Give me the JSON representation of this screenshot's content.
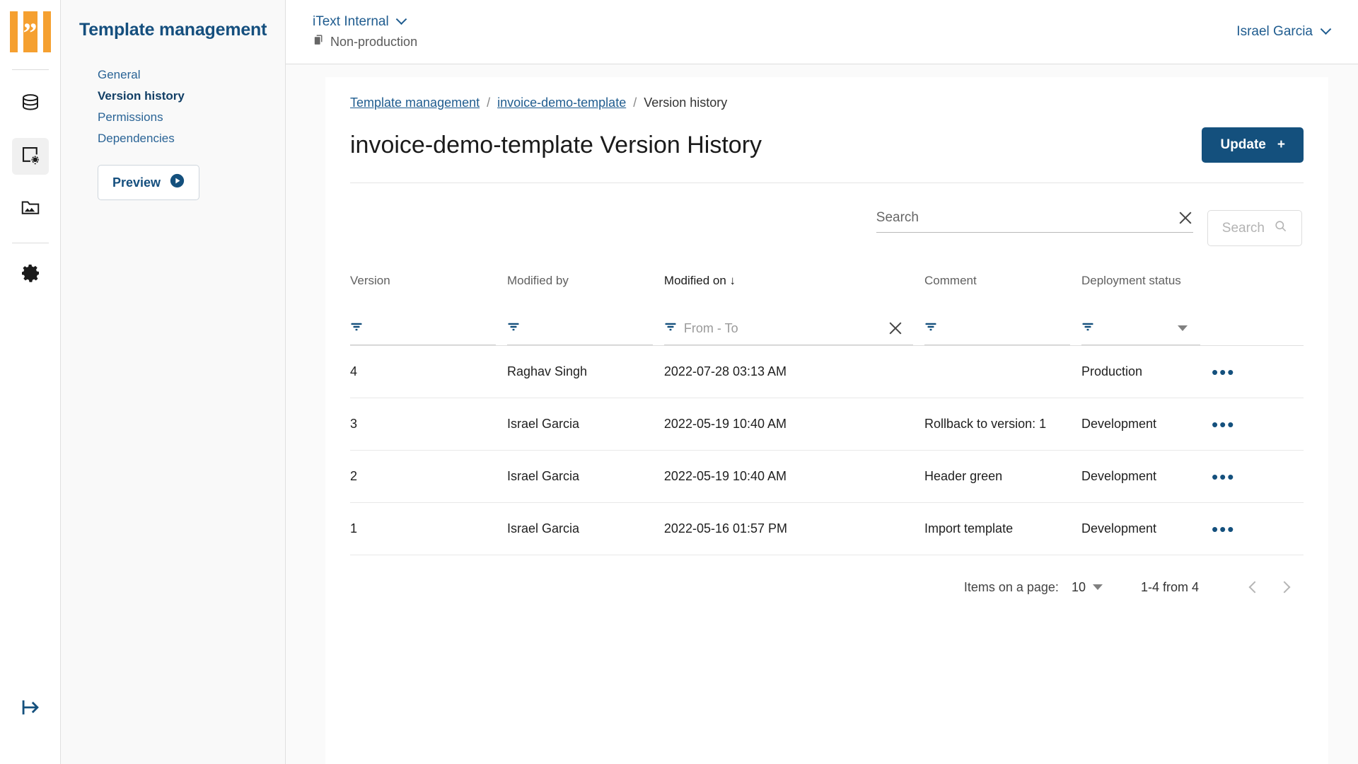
{
  "brand": {
    "logo_alt": "iText logo",
    "accent": "#f5a030",
    "primary": "#14507d"
  },
  "rail": {
    "items": [
      {
        "name": "database-icon",
        "label": "Data"
      },
      {
        "name": "template-settings-icon",
        "label": "Templates",
        "active": true
      },
      {
        "name": "image-folder-icon",
        "label": "Assets"
      },
      {
        "name": "gear-icon",
        "label": "Settings"
      }
    ],
    "collapse_label": "Expand menu"
  },
  "sidebar": {
    "title": "Template management",
    "items": [
      {
        "label": "General",
        "active": false
      },
      {
        "label": "Version history",
        "active": true
      },
      {
        "label": "Permissions",
        "active": false
      },
      {
        "label": "Dependencies",
        "active": false
      }
    ],
    "preview_label": "Preview"
  },
  "topbar": {
    "tenant": "iText Internal",
    "environment": "Non-production",
    "user": "Israel Garcia"
  },
  "breadcrumb": {
    "item1": "Template management",
    "item2": "invoice-demo-template",
    "item3": "Version history",
    "sep": "/"
  },
  "page": {
    "title": "invoice-demo-template Version History",
    "update_label": "Update",
    "update_plus": "+"
  },
  "search": {
    "value": "",
    "placeholder": "Search",
    "button_label": "Search"
  },
  "table": {
    "columns": [
      {
        "label": "Version",
        "sorted": false
      },
      {
        "label": "Modified by",
        "sorted": false
      },
      {
        "label": "Modified on",
        "sorted": true,
        "sort_dir": "↓"
      },
      {
        "label": "Comment",
        "sorted": false
      },
      {
        "label": "Deployment status",
        "sorted": false
      }
    ],
    "date_filter_placeholder": "From - To",
    "rows": [
      {
        "version": "4",
        "modified_by": "Raghav Singh",
        "modified_on": "2022-07-28 03:13 AM",
        "comment": "",
        "status": "Production",
        "actions": "•••"
      },
      {
        "version": "3",
        "modified_by": "Israel Garcia",
        "modified_on": "2022-05-19 10:40 AM",
        "comment": "Rollback to version: 1",
        "status": "Development",
        "actions": "•••"
      },
      {
        "version": "2",
        "modified_by": "Israel Garcia",
        "modified_on": "2022-05-19 10:40 AM",
        "comment": "Header green",
        "status": "Development",
        "actions": "•••"
      },
      {
        "version": "1",
        "modified_by": "Israel Garcia",
        "modified_on": "2022-05-16 01:57 PM",
        "comment": "Import template",
        "status": "Development",
        "actions": "•••"
      }
    ]
  },
  "pagination": {
    "items_label": "Items on a page:",
    "page_size": "10",
    "range": "1-4 from 4"
  }
}
